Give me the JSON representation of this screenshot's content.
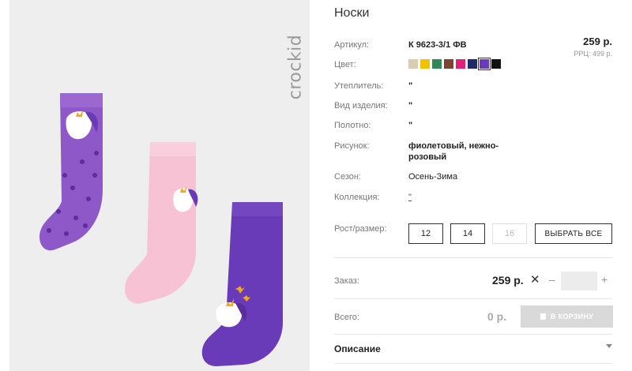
{
  "photo": {
    "brand": "crockid",
    "sock_colors": {
      "lilac": "#8e58c8",
      "pink": "#f7c2d4",
      "violet": "#6a3bb8",
      "star": "#5c2d9c",
      "gold": "#f0a820"
    }
  },
  "product": {
    "title": "Носки",
    "price": "259 р.",
    "rrp": "РРЦ: 499 р."
  },
  "specs": [
    {
      "label": "Артикул:",
      "value": "К 9623-3/1 ФВ"
    },
    {
      "label": "Цвет:"
    },
    {
      "label": "Утеплитель:",
      "value": "\""
    },
    {
      "label": "Вид изделия:",
      "value": "\""
    },
    {
      "label": "Полотно:",
      "value": "\""
    },
    {
      "label": "Рисунок:",
      "value_line1": "фиолетовый, нежно-",
      "value_line2": "розовый"
    },
    {
      "label": "Сезон:",
      "value": "Осень-Зима"
    },
    {
      "label": "Коллекция:",
      "value": "\""
    },
    {
      "label": "Рост/размер:"
    }
  ],
  "colors": [
    {
      "name": "beige",
      "hex": "#d8cdb3"
    },
    {
      "name": "yellow",
      "hex": "#f2c200"
    },
    {
      "name": "green",
      "hex": "#2e8b57"
    },
    {
      "name": "brown",
      "hex": "#7a4332"
    },
    {
      "name": "magenta",
      "hex": "#e2207a"
    },
    {
      "name": "navy",
      "hex": "#1f2a6b"
    },
    {
      "name": "violet",
      "hex": "#6a3bb8",
      "selected": true
    },
    {
      "name": "black",
      "hex": "#111111"
    }
  ],
  "sizes": {
    "options": [
      {
        "label": "12",
        "available": true
      },
      {
        "label": "14",
        "available": true
      },
      {
        "label": "16",
        "available": false
      }
    ],
    "select_all": "ВЫБРАТЬ ВСЕ"
  },
  "order": {
    "label": "Заказ:",
    "price": "259 р.",
    "times": "✕",
    "minus": "–",
    "plus": "+",
    "quantity": ""
  },
  "total": {
    "label": "Всего:",
    "price": "0 р.",
    "cart_button": "В КОРЗИНУ"
  },
  "description": {
    "label": "Описание"
  }
}
